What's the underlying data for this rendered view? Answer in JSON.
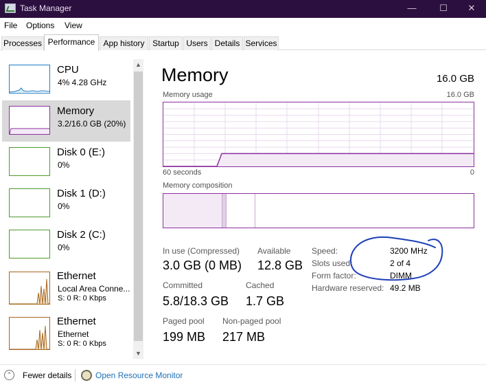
{
  "window": {
    "title": "Task Manager",
    "minimize_glyph": "—",
    "maximize_glyph": "☐",
    "close_glyph": "✕",
    "app_icon": "task-manager-icon"
  },
  "menu": {
    "file": "File",
    "options": "Options",
    "view": "View"
  },
  "tabs": [
    {
      "label": "Processes"
    },
    {
      "label": "Performance",
      "active": true
    },
    {
      "label": "App history"
    },
    {
      "label": "Startup"
    },
    {
      "label": "Users"
    },
    {
      "label": "Details"
    },
    {
      "label": "Services"
    }
  ],
  "sidebar": {
    "cpu": {
      "name": "CPU",
      "value": "4%  4.28 GHz",
      "color": "#1f7cc4"
    },
    "memory": {
      "name": "Memory",
      "value": "3.2/16.0 GB (20%)",
      "color": "#8b2f9e"
    },
    "disk0": {
      "name": "Disk 0 (E:)",
      "value": "0%",
      "color": "#4a9a2c"
    },
    "disk1": {
      "name": "Disk 1 (D:)",
      "value": "0%",
      "color": "#4a9a2c"
    },
    "disk2": {
      "name": "Disk 2 (C:)",
      "value": "0%",
      "color": "#4a9a2c"
    },
    "eth1": {
      "name": "Ethernet",
      "adapter": "Local Area Conne...",
      "value": "S: 0  R: 0 Kbps",
      "color": "#a7661b"
    },
    "eth2": {
      "name": "Ethernet",
      "adapter": "Ethernet",
      "value": "S: 0  R: 0 Kbps",
      "color": "#a7661b"
    },
    "scroll_up": "▲",
    "scroll_down": "▼"
  },
  "main": {
    "title": "Memory",
    "total": "16.0 GB",
    "usage_label": "Memory usage",
    "usage_max": "16.0 GB",
    "time_span": "60 seconds",
    "time_end": "0",
    "composition_label": "Memory composition",
    "usage_fraction": 0.2,
    "stats": {
      "in_use_label": "In use (Compressed)",
      "in_use_value": "3.0 GB (0 MB)",
      "available_label": "Available",
      "available_value": "12.8 GB",
      "committed_label": "Committed",
      "committed_value": "5.8/18.3 GB",
      "cached_label": "Cached",
      "cached_value": "1.7 GB",
      "paged_label": "Paged pool",
      "paged_value": "199 MB",
      "nonpaged_label": "Non-paged pool",
      "nonpaged_value": "217 MB"
    },
    "specs": {
      "speed_label": "Speed:",
      "speed_value": "3200 MHz",
      "slots_label": "Slots used:",
      "slots_value": "2 of 4",
      "form_label": "Form factor:",
      "form_value": "DIMM",
      "reserved_label": "Hardware reserved:",
      "reserved_value": "49.2 MB"
    }
  },
  "footer": {
    "fewer_details": "Fewer details",
    "fewer_icon": "chevron-up-icon",
    "open_monitor": "Open Resource Monitor",
    "monitor_icon": "resource-monitor-icon"
  }
}
